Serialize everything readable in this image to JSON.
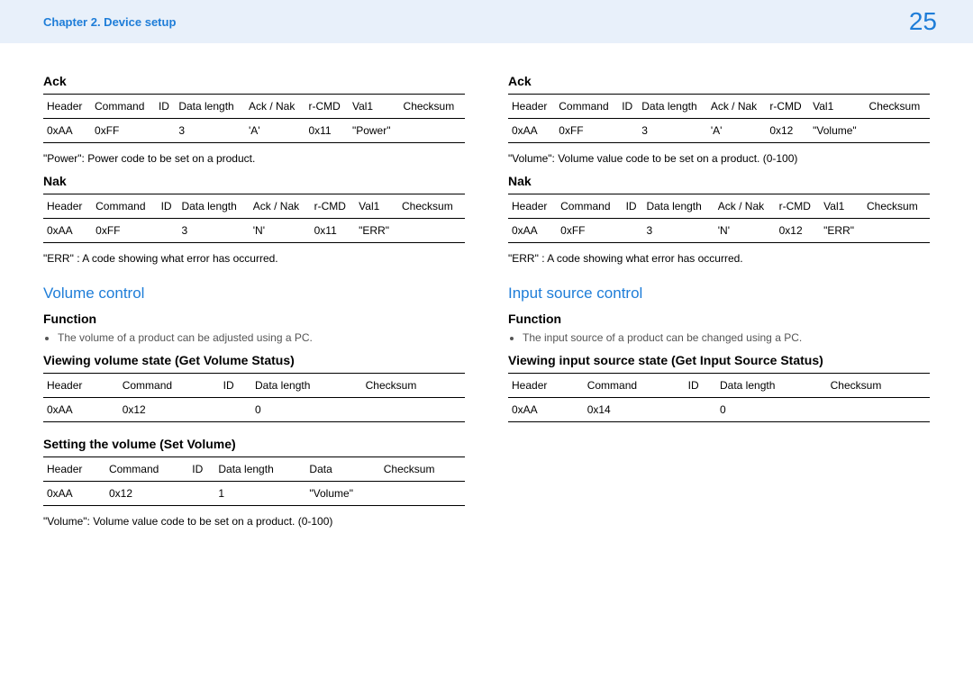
{
  "header": {
    "chapter": "Chapter 2. Device setup",
    "page": "25"
  },
  "left": {
    "ack": {
      "title": "Ack",
      "headers": [
        "Header",
        "Command",
        "ID",
        "Data length",
        "Ack / Nak",
        "r-CMD",
        "Val1",
        "Checksum"
      ],
      "row": [
        "0xAA",
        "0xFF",
        "",
        "3",
        "'A'",
        "0x11",
        "\"Power\"",
        ""
      ],
      "note": "\"Power\": Power code to be set on a product."
    },
    "nak": {
      "title": "Nak",
      "headers": [
        "Header",
        "Command",
        "ID",
        "Data length",
        "Ack / Nak",
        "r-CMD",
        "Val1",
        "Checksum"
      ],
      "row": [
        "0xAA",
        "0xFF",
        "",
        "3",
        "'N'",
        "0x11",
        "\"ERR\"",
        ""
      ],
      "note": "\"ERR\" : A code showing what error has occurred."
    },
    "section": {
      "title": "Volume control",
      "funcTitle": "Function",
      "funcBullet": "The volume of a product can be adjusted using a PC.",
      "view": {
        "title": "Viewing volume state (Get Volume Status)",
        "headers": [
          "Header",
          "Command",
          "ID",
          "Data length",
          "Checksum"
        ],
        "row": [
          "0xAA",
          "0x12",
          "",
          "0",
          ""
        ]
      },
      "set": {
        "title": "Setting the volume (Set Volume)",
        "headers": [
          "Header",
          "Command",
          "ID",
          "Data length",
          "Data",
          "Checksum"
        ],
        "row": [
          "0xAA",
          "0x12",
          "",
          "1",
          "\"Volume\"",
          ""
        ],
        "note": "\"Volume\": Volume value code to be set on a product. (0-100)"
      }
    }
  },
  "right": {
    "ack": {
      "title": "Ack",
      "headers": [
        "Header",
        "Command",
        "ID",
        "Data length",
        "Ack / Nak",
        "r-CMD",
        "Val1",
        "Checksum"
      ],
      "row": [
        "0xAA",
        "0xFF",
        "",
        "3",
        "'A'",
        "0x12",
        "\"Volume\"",
        ""
      ],
      "note": "\"Volume\": Volume value code to be set on a product. (0-100)"
    },
    "nak": {
      "title": "Nak",
      "headers": [
        "Header",
        "Command",
        "ID",
        "Data length",
        "Ack / Nak",
        "r-CMD",
        "Val1",
        "Checksum"
      ],
      "row": [
        "0xAA",
        "0xFF",
        "",
        "3",
        "'N'",
        "0x12",
        "\"ERR\"",
        ""
      ],
      "note": "\"ERR\" : A code showing what error has occurred."
    },
    "section": {
      "title": "Input source control",
      "funcTitle": "Function",
      "funcBullet": "The input source of a product can be changed using a PC.",
      "view": {
        "title": "Viewing input source state (Get Input Source Status)",
        "headers": [
          "Header",
          "Command",
          "ID",
          "Data length",
          "Checksum"
        ],
        "row": [
          "0xAA",
          "0x14",
          "",
          "0",
          ""
        ]
      }
    }
  }
}
